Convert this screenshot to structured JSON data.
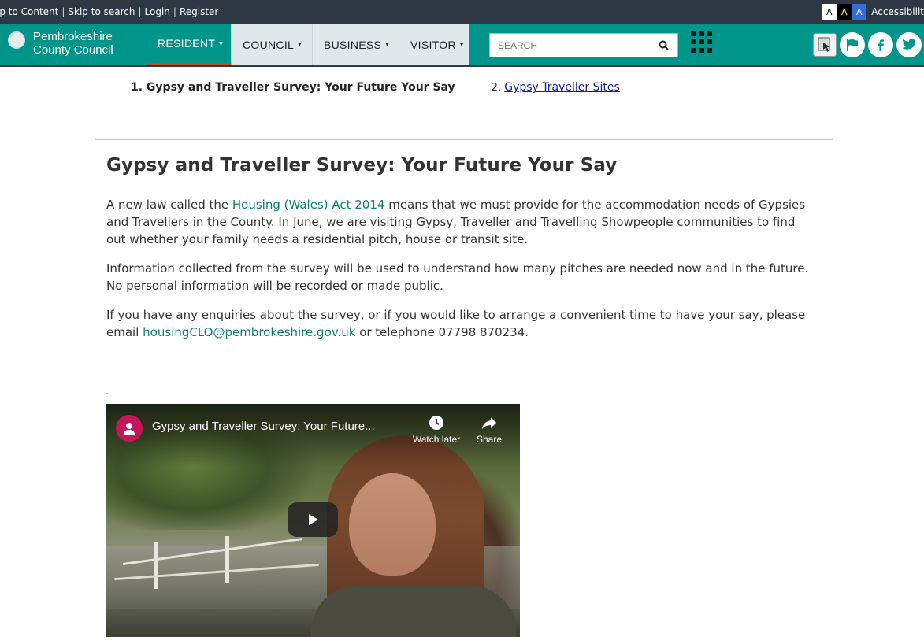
{
  "utility": {
    "skip_content": "ip to Content",
    "skip_search": "Skip to search",
    "login": "Login",
    "register": "Register",
    "sep": "|",
    "text_size_a1": "A",
    "text_size_a2": "A",
    "text_size_a3": "A",
    "accessibility": "Accessibilit"
  },
  "header": {
    "logo_line1": "Pembrokeshire",
    "logo_line2": "County Council",
    "nav": [
      {
        "label": "RESIDENT",
        "caret": "▾"
      },
      {
        "label": "COUNCIL",
        "caret": "▾"
      },
      {
        "label": "BUSINESS",
        "caret": "▾"
      },
      {
        "label": "VISITOR",
        "caret": "▾"
      }
    ],
    "search_placeholder": "SEARCH",
    "colors": {
      "brand": "#00958a",
      "utility_bg": "#2e3845",
      "active_underline": "#c84b1c",
      "link": "#0e7f73"
    }
  },
  "steps": {
    "step1": "1. Gypsy and Traveller Survey: Your Future Your Say",
    "step2_num": "2.",
    "step2_link": "Gypsy Traveller Sites"
  },
  "article": {
    "title": "Gypsy and Traveller Survey: Your Future Your Say",
    "p1_pre": "A new law called the ",
    "p1_link": "Housing (Wales) Act 2014",
    "p1_post": " means that we must provide for the accommodation needs of Gypsies and Travellers in the County. In June, we are visiting Gypsy, Traveller and Travelling Showpeople communities to find out whether your family needs a residential pitch, house or transit site.",
    "p2": "Information collected from the survey will be used to understand how many pitches are needed now and in the future. No personal information will be recorded or made public.",
    "p3_pre": "If you have any enquiries about the survey, or if you would like to arrange a convenient time to have your say, please email ",
    "p3_link": "housingCLO@pembrokeshire.gov.uk",
    "p3_post": " or telephone 07798 870234.",
    "dash": "-"
  },
  "video": {
    "title": "Gypsy and Traveller Survey: Your Future...",
    "watch_later": "Watch later",
    "share": "Share"
  }
}
